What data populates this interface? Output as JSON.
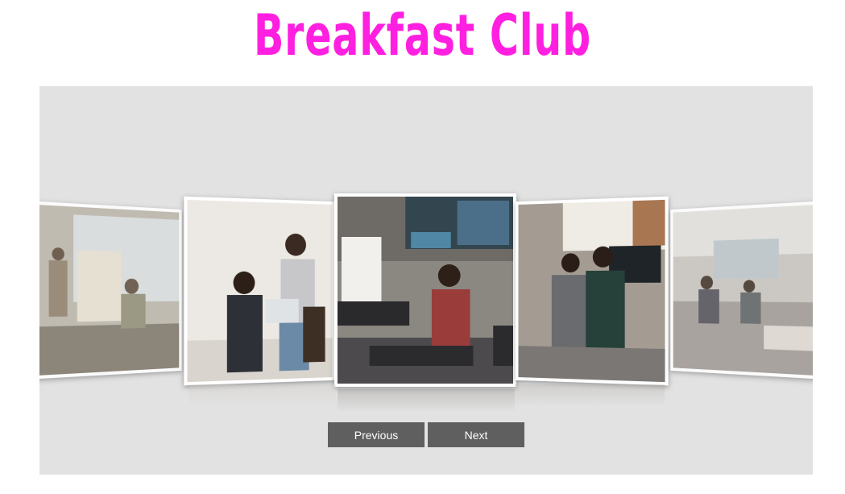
{
  "page": {
    "title": "Breakfast Club"
  },
  "carousel": {
    "slides": [
      {
        "subject": "meeting room with whiteboard"
      },
      {
        "subject": "two people on couch with laptop"
      },
      {
        "subject": "man sitting on floor by screen"
      },
      {
        "subject": "two people posing in office"
      },
      {
        "subject": "group in lounge area"
      }
    ],
    "active_index": 2
  },
  "controls": {
    "previous_label": "Previous",
    "next_label": "Next"
  }
}
